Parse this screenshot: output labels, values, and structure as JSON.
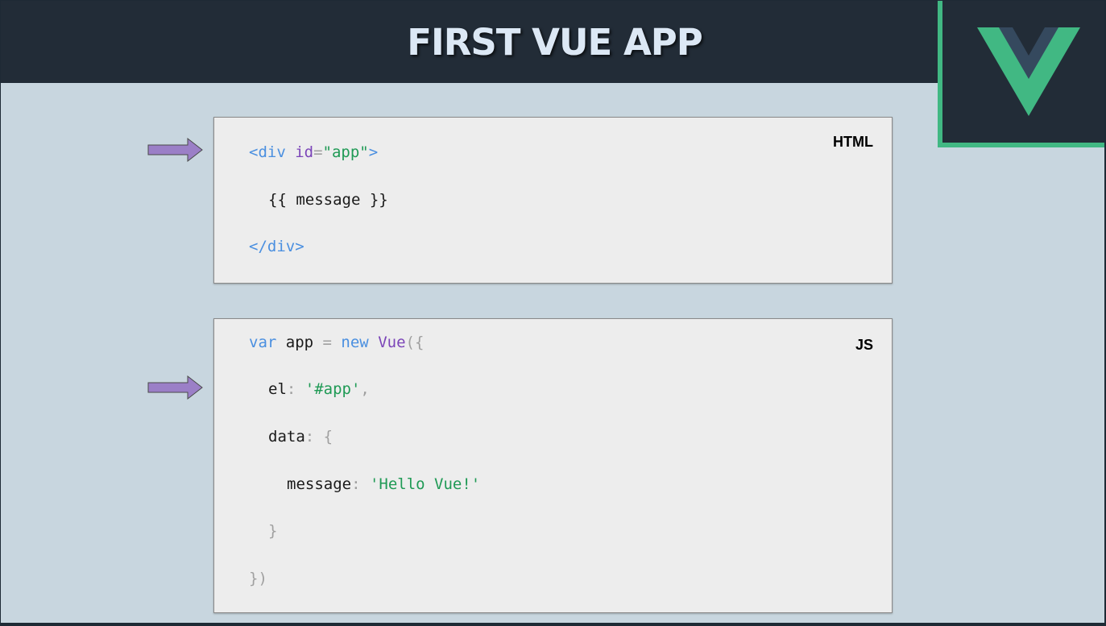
{
  "slide": {
    "title": "FIRST VUE APP"
  },
  "colors": {
    "header_bg": "#222c37",
    "slide_bg": "#c8d6df",
    "vue_green": "#41b883",
    "vue_dark": "#35495e",
    "arrow_purple": "#9b7fc7",
    "card_bg": "#ededed"
  },
  "logo": {
    "icon": "vue-logo-icon"
  },
  "arrows": {
    "icon": "right-arrow-icon",
    "count": 2
  },
  "html_block": {
    "label": "HTML",
    "line1": {
      "open": "<div ",
      "attr": "id",
      "eq": "=",
      "val": "\"app\"",
      "close": ">"
    },
    "line2": "{{ message }}",
    "line3": "</div>"
  },
  "js_block": {
    "label": "JS",
    "line1": {
      "kw1": "var",
      "name": " app ",
      "eq": "=",
      "kw2": " new ",
      "cls": "Vue",
      "punc": "({"
    },
    "line2": {
      "key": "el",
      "colon": ": ",
      "val": "'#app'",
      "comma": ","
    },
    "line3": {
      "key": "data",
      "colon": ": ",
      "brace": "{"
    },
    "line4": {
      "key": "message",
      "colon": ": ",
      "val": "'Hello Vue!'"
    },
    "line5": "}",
    "line6": "})"
  }
}
